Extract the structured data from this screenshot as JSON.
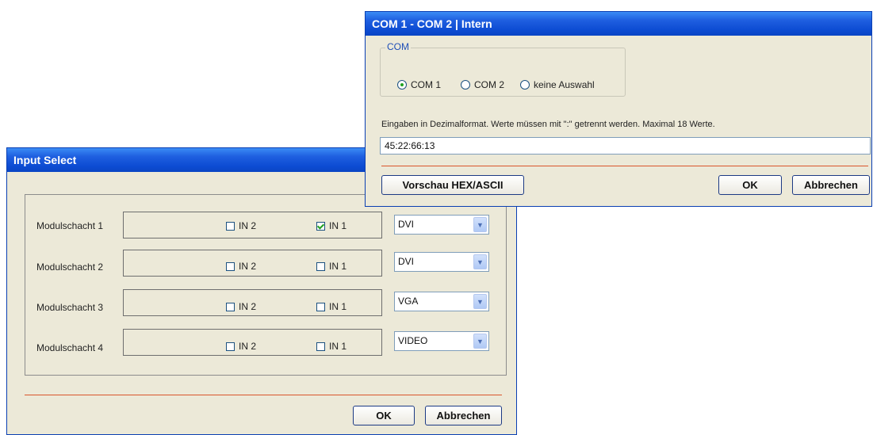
{
  "input_select": {
    "title": "Input Select",
    "rows": [
      {
        "label": "Modulschacht 1",
        "in2": {
          "label": "IN 2",
          "checked": false
        },
        "in1": {
          "label": "IN 1",
          "checked": true
        },
        "select": "DVI"
      },
      {
        "label": "Modulschacht 2",
        "in2": {
          "label": "IN 2",
          "checked": false
        },
        "in1": {
          "label": "IN 1",
          "checked": false
        },
        "select": "DVI"
      },
      {
        "label": "Modulschacht 3",
        "in2": {
          "label": "IN 2",
          "checked": false
        },
        "in1": {
          "label": "IN 1",
          "checked": false
        },
        "select": "VGA"
      },
      {
        "label": "Modulschacht 4",
        "in2": {
          "label": "IN 2",
          "checked": false
        },
        "in1": {
          "label": "IN 1",
          "checked": false
        },
        "select": "VIDEO"
      }
    ],
    "ok_label": "OK",
    "cancel_label": "Abbrechen"
  },
  "com_dialog": {
    "title": "COM 1 - COM 2 | Intern",
    "group_label": "COM",
    "radios": [
      {
        "label": "COM 1",
        "selected": true
      },
      {
        "label": "COM 2",
        "selected": false
      },
      {
        "label": "keine Auswahl",
        "selected": false
      }
    ],
    "info_text": "Eingaben in Dezimalformat. Werte müssen mit \":\" getrennt werden. Maximal 18 Werte.",
    "input_value": "45:22:66:13",
    "preview_label": "Vorschau HEX/ASCII",
    "ok_label": "OK",
    "cancel_label": "Abbrechen"
  },
  "colors": {
    "title_bar": "#0d4cd3",
    "window_bg": "#ece9d8",
    "separator": "#d9552b",
    "check_mark": "#21a121"
  }
}
